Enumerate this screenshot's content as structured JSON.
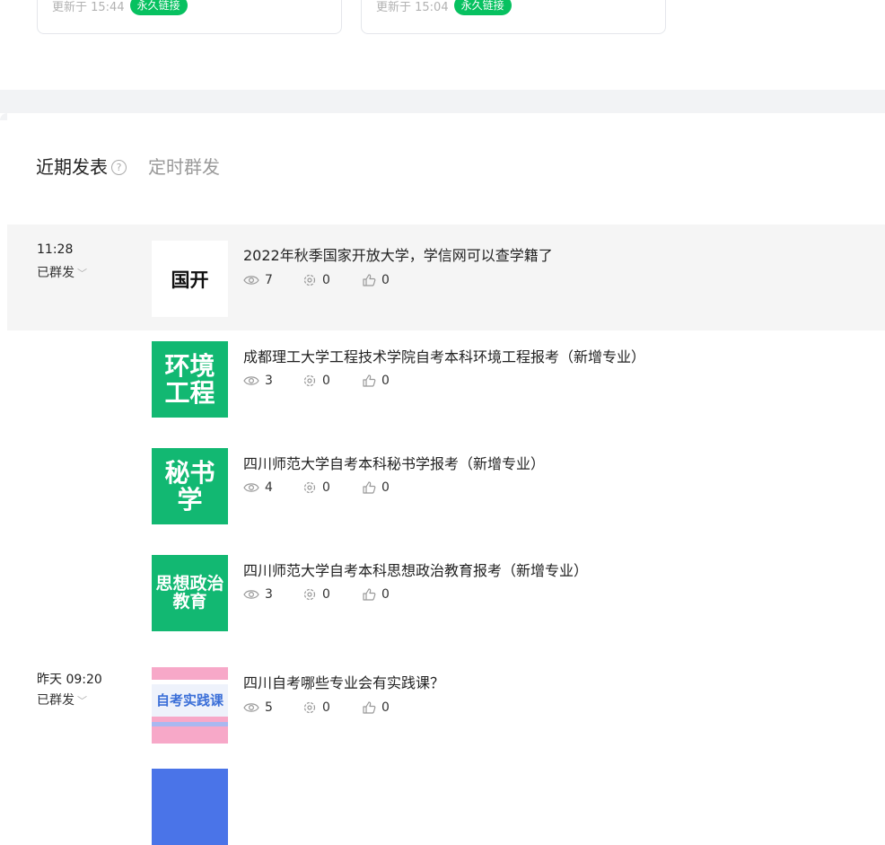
{
  "cards": [
    {
      "updated": "更新于 15:44",
      "badge": "永久链接"
    },
    {
      "updated": "更新于 15:04",
      "badge": "永久链接"
    }
  ],
  "tabs": {
    "recent": "近期发表",
    "help": "?",
    "scheduled": "定时群发"
  },
  "groups": [
    {
      "time": "11:28",
      "status": "已群发"
    },
    {
      "time": "昨天 09:20",
      "status": "已群发"
    }
  ],
  "articles": [
    {
      "thumb_text": "国开",
      "title": "2022年秋季国家开放大学，学信网可以查学籍了",
      "views": "7",
      "shares": "0",
      "likes": "0"
    },
    {
      "thumb_text": "环境工程",
      "title": "成都理工大学工程技术学院自考本科环境工程报考（新增专业）",
      "views": "3",
      "shares": "0",
      "likes": "0"
    },
    {
      "thumb_text": "秘书学",
      "title": "四川师范大学自考本科秘书学报考（新增专业）",
      "views": "4",
      "shares": "0",
      "likes": "0"
    },
    {
      "thumb_text": "思想政治教育",
      "title": "四川师范大学自考本科思想政治教育报考（新增专业）",
      "views": "3",
      "shares": "0",
      "likes": "0"
    },
    {
      "thumb_text": "自考实践课",
      "title": "四川自考哪些专业会有实践课？",
      "views": "5",
      "shares": "0",
      "likes": "0"
    }
  ],
  "icons": {
    "view": "eye-icon",
    "share": "share-icon",
    "like": "thumbs-up-icon",
    "chevron": "chevron-down-icon",
    "help": "help-circle-icon"
  },
  "colors": {
    "badge": "#07c160",
    "thumb_green": "#12b872"
  }
}
